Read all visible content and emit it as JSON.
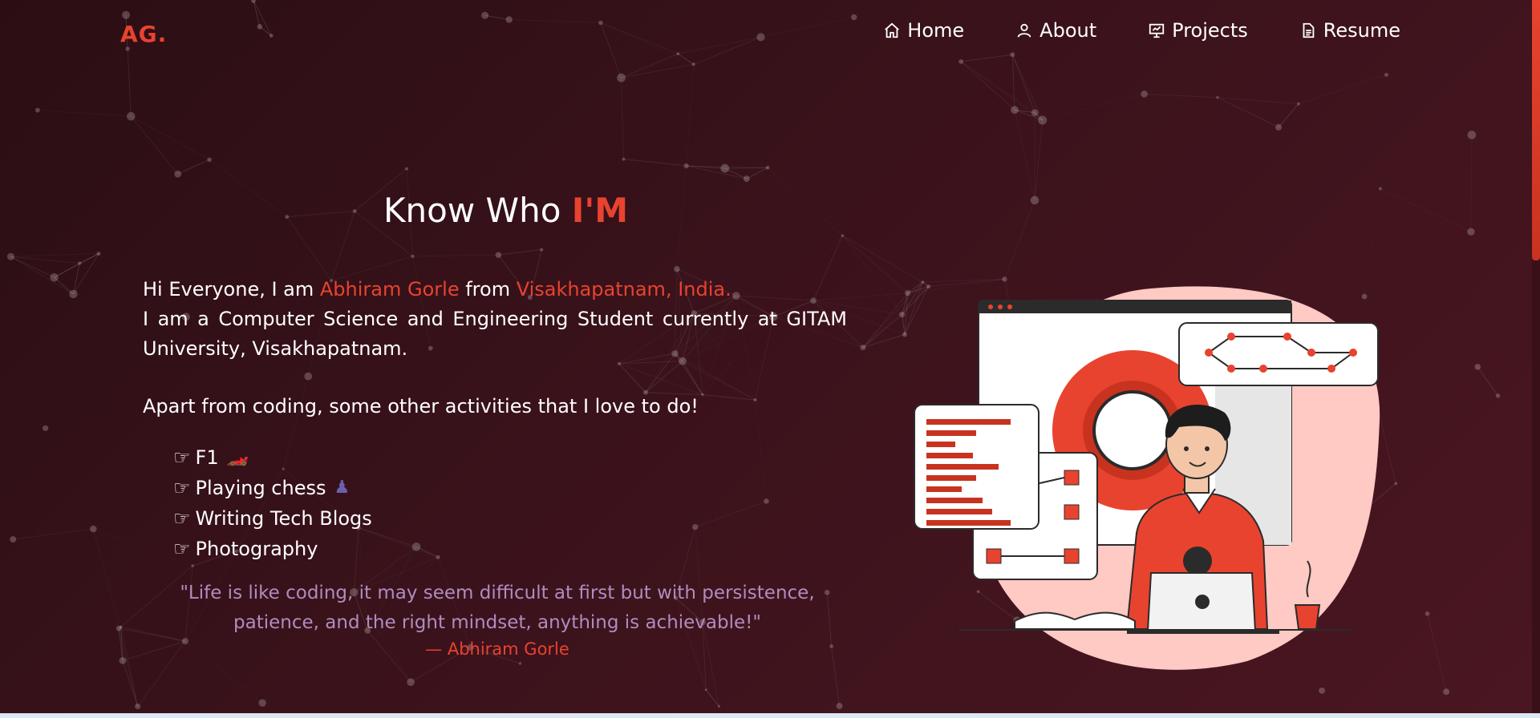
{
  "logo": "AG.",
  "nav": {
    "items": [
      {
        "label": "Home",
        "icon": "home-icon"
      },
      {
        "label": "About",
        "icon": "user-icon"
      },
      {
        "label": "Projects",
        "icon": "presentation-icon"
      },
      {
        "label": "Resume",
        "icon": "document-icon"
      }
    ]
  },
  "about": {
    "title_prefix": "Know Who ",
    "title_accent": "I'M",
    "intro_greeting": "Hi Everyone, I am ",
    "intro_name": "Abhiram Gorle",
    "intro_from": " from ",
    "intro_location": "Visakhapatnam, India.",
    "intro_line2": "I am a Computer Science and Engineering Student currently at GITAM University, Visakhapatnam.",
    "activities_intro": "Apart from coding, some other activities that I love to do!",
    "activities": [
      {
        "label": "F1",
        "emoji": "🏎️"
      },
      {
        "label": "Playing chess",
        "emoji": "♟"
      },
      {
        "label": "Writing Tech Blogs",
        "emoji": ""
      },
      {
        "label": "Photography",
        "emoji": ""
      }
    ],
    "quote": "\"Life is like coding, it may seem difficult at first but with persistence, patience, and the right mindset, anything is achievable!\"",
    "author": "— Abhiram Gorle"
  },
  "colors": {
    "accent": "#e8432f",
    "quote": "#b08cbf",
    "background": "#3a121b"
  }
}
